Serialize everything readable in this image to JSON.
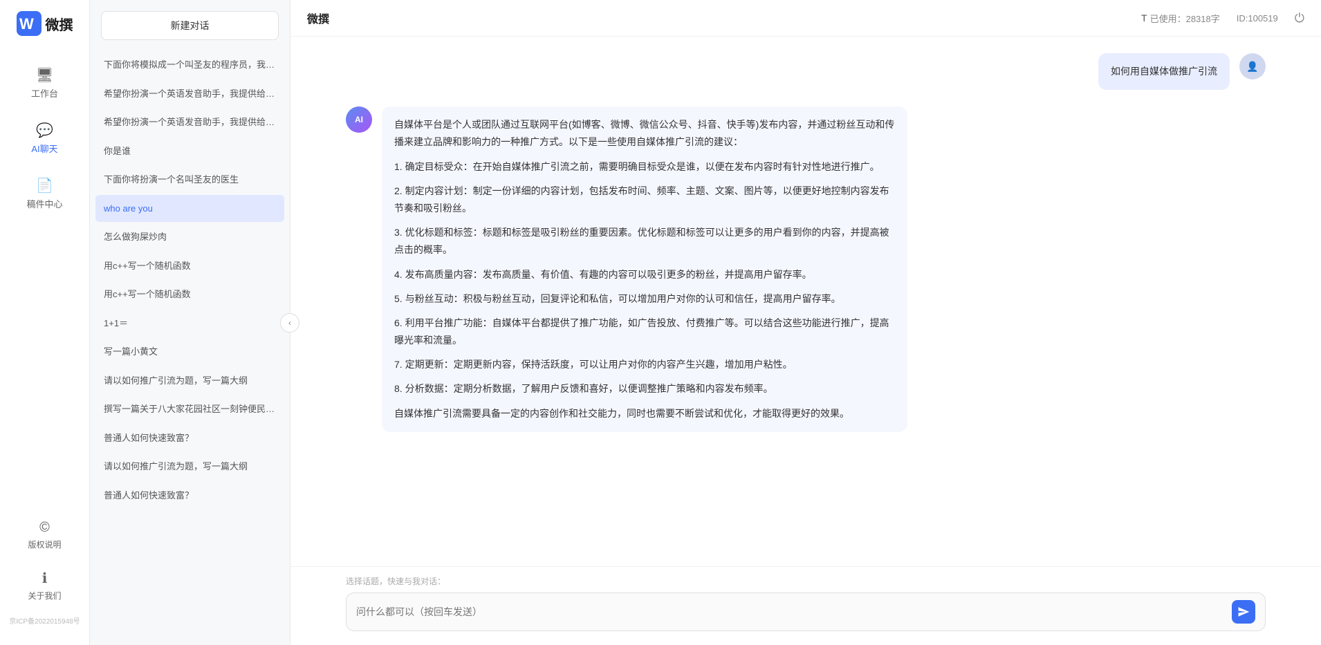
{
  "app": {
    "name": "微撰",
    "title": "微撰"
  },
  "header": {
    "title": "微撰",
    "usage_label": "已使用：28318字",
    "id_label": "ID:100519",
    "usage_icon": "T"
  },
  "sidebar": {
    "nav_items": [
      {
        "id": "workbench",
        "label": "工作台",
        "icon": "🖥"
      },
      {
        "id": "aichat",
        "label": "AI聊天",
        "icon": "💬",
        "active": true
      },
      {
        "id": "drafts",
        "label": "稿件中心",
        "icon": "📄"
      }
    ],
    "bottom_items": [
      {
        "id": "copyright",
        "label": "版权说明",
        "icon": "©"
      },
      {
        "id": "about",
        "label": "关于我们",
        "icon": "ℹ"
      }
    ],
    "icp": "京ICP备2022015948号"
  },
  "middle": {
    "new_chat_label": "新建对话",
    "chat_list": [
      {
        "id": 1,
        "text": "下面你将模拟成一个叫圣友的程序员，我说...",
        "active": false
      },
      {
        "id": 2,
        "text": "希望你扮演一个英语发音助手，我提供给你...",
        "active": false
      },
      {
        "id": 3,
        "text": "希望你扮演一个英语发音助手，我提供给你...",
        "active": false
      },
      {
        "id": 4,
        "text": "你是谁",
        "active": false
      },
      {
        "id": 5,
        "text": "下面你将扮演一个名叫圣友的医生",
        "active": false
      },
      {
        "id": 6,
        "text": "who are you",
        "active": true
      },
      {
        "id": 7,
        "text": "怎么做狗屎炒肉",
        "active": false
      },
      {
        "id": 8,
        "text": "用c++写一个随机函数",
        "active": false
      },
      {
        "id": 9,
        "text": "用c++写一个随机函数",
        "active": false
      },
      {
        "id": 10,
        "text": "1+1＝",
        "active": false
      },
      {
        "id": 11,
        "text": "写一篇小黄文",
        "active": false
      },
      {
        "id": 12,
        "text": "请以如何推广引流为题，写一篇大纲",
        "active": false
      },
      {
        "id": 13,
        "text": "撰写一篇关于八大家花园社区一刻钟便民生...",
        "active": false
      },
      {
        "id": 14,
        "text": "普通人如何快速致富？",
        "active": false
      },
      {
        "id": 15,
        "text": "请以如何推广引流为题，写一篇大纲",
        "active": false
      },
      {
        "id": 16,
        "text": "普通人如何快速致富？",
        "active": false
      }
    ]
  },
  "chat": {
    "messages": [
      {
        "role": "user",
        "text": "如何用自媒体做推广引流",
        "avatar_type": "user"
      },
      {
        "role": "ai",
        "paragraphs": [
          "自媒体平台是个人或团队通过互联网平台(如博客、微博、微信公众号、抖音、快手等)发布内容，并通过粉丝互动和传播来建立品牌和影响力的一种推广方式。以下是一些使用自媒体推广引流的建议：",
          "1. 确定目标受众：在开始自媒体推广引流之前，需要明确目标受众是谁，以便在发布内容时有针对性地进行推广。",
          "2. 制定内容计划：制定一份详细的内容计划，包括发布时间、频率、主题、文案、图片等，以便更好地控制内容发布节奏和吸引粉丝。",
          "3. 优化标题和标签：标题和标签是吸引粉丝的重要因素。优化标题和标签可以让更多的用户看到你的内容，并提高被点击的概率。",
          "4. 发布高质量内容：发布高质量、有价值、有趣的内容可以吸引更多的粉丝，并提高用户留存率。",
          "5. 与粉丝互动：积极与粉丝互动，回复评论和私信，可以增加用户对你的认可和信任，提高用户留存率。",
          "6. 利用平台推广功能：自媒体平台都提供了推广功能，如广告投放、付费推广等。可以结合这些功能进行推广，提高曝光率和流量。",
          "7. 定期更新：定期更新内容，保持活跃度，可以让用户对你的内容产生兴趣，增加用户粘性。",
          "8. 分析数据：定期分析数据，了解用户反馈和喜好，以便调整推广策略和内容发布频率。",
          "自媒体推广引流需要具备一定的内容创作和社交能力，同时也需要不断尝试和优化，才能取得更好的效果。"
        ],
        "avatar_type": "ai"
      }
    ],
    "input": {
      "placeholder": "问什么都可以（按回车发送）",
      "quick_topics_label": "选择话题，快速与我对话："
    }
  }
}
